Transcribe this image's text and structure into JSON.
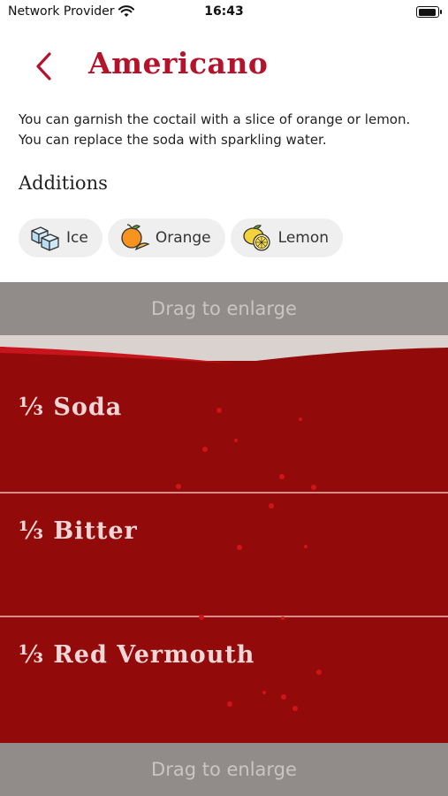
{
  "status": {
    "carrier": "Network Provider",
    "time": "16:43",
    "battery_level": 0.95
  },
  "header": {
    "back_icon": "chevron-left-icon",
    "title": "Americano"
  },
  "description": "You can garnish the coctail with a slice of orange or lemon. You can replace the soda with sparkling water.",
  "additions": {
    "heading": "Additions",
    "items": [
      {
        "label": "Ice",
        "icon": "ice-cubes-icon"
      },
      {
        "label": "Orange",
        "icon": "orange-icon"
      },
      {
        "label": "Lemon",
        "icon": "lemon-icon"
      }
    ]
  },
  "drag_hint": "Drag to enlarge",
  "layers": [
    {
      "label": "⅓ Soda"
    },
    {
      "label": "⅓ Bitter"
    },
    {
      "label": "⅓ Red Vermouth"
    }
  ],
  "colors": {
    "accent": "#b5122c",
    "liquid": "#930a0a",
    "drag_bar": "#918c89"
  }
}
